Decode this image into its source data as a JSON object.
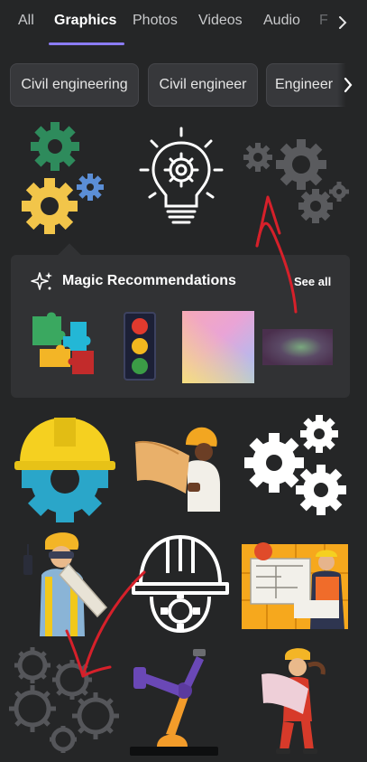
{
  "tabs": {
    "items": [
      "All",
      "Graphics",
      "Photos",
      "Videos",
      "Audio"
    ],
    "overflow_label": "F",
    "active": "Graphics"
  },
  "chips": [
    "Civil engineering",
    "Civil engineer",
    "Engineer"
  ],
  "magic": {
    "title": "Magic Recommendations",
    "see_all": "See all"
  },
  "colors": {
    "background": "#252627",
    "accent": "#8b7cf6",
    "panel": "#313234",
    "annotation": "#d6202a"
  },
  "icons": [
    "chevron-right-icon",
    "sparkle-icon"
  ]
}
